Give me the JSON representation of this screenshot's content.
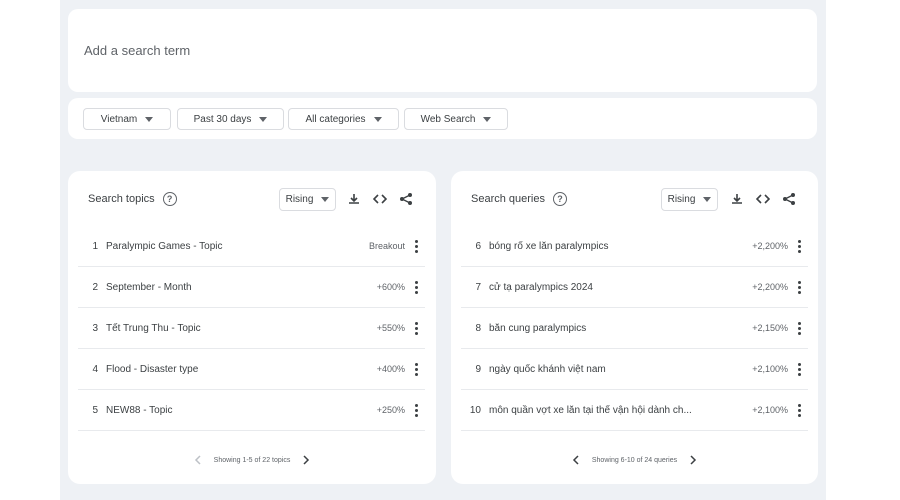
{
  "search": {
    "placeholder": "Add a search term"
  },
  "filters": [
    {
      "label": "Vietnam"
    },
    {
      "label": "Past 30 days"
    },
    {
      "label": "All categories"
    },
    {
      "label": "Web Search"
    }
  ],
  "topics": {
    "title": "Search topics",
    "selector": "Rising",
    "rows": [
      {
        "num": "1",
        "label": "Paralympic Games - Topic",
        "value": "Breakout"
      },
      {
        "num": "2",
        "label": "September - Month",
        "value": "+600%"
      },
      {
        "num": "3",
        "label": "Tết Trung Thu - Topic",
        "value": "+550%"
      },
      {
        "num": "4",
        "label": "Flood - Disaster type",
        "value": "+400%"
      },
      {
        "num": "5",
        "label": "NEW88 - Topic",
        "value": "+250%"
      }
    ],
    "pager": "Showing 1-5 of 22 topics"
  },
  "queries": {
    "title": "Search queries",
    "selector": "Rising",
    "rows": [
      {
        "num": "6",
        "label": "bóng rổ xe lăn paralympics",
        "value": "+2,200%"
      },
      {
        "num": "7",
        "label": "cử tạ paralympics 2024",
        "value": "+2,200%"
      },
      {
        "num": "8",
        "label": "bắn cung paralympics",
        "value": "+2,150%"
      },
      {
        "num": "9",
        "label": "ngày quốc khánh việt nam",
        "value": "+2,100%"
      },
      {
        "num": "10",
        "label": "môn quần vợt xe lăn tại thế vận hội dành ch...",
        "value": "+2,100%"
      }
    ],
    "pager": "Showing 6-10 of 24 queries"
  },
  "icons": {
    "help": "help-circle-icon",
    "download": "download-icon",
    "embed": "code-embed-icon",
    "share": "share-icon",
    "more": "more-vert-icon",
    "prev": "chevron-left-icon",
    "next": "chevron-right-icon"
  }
}
